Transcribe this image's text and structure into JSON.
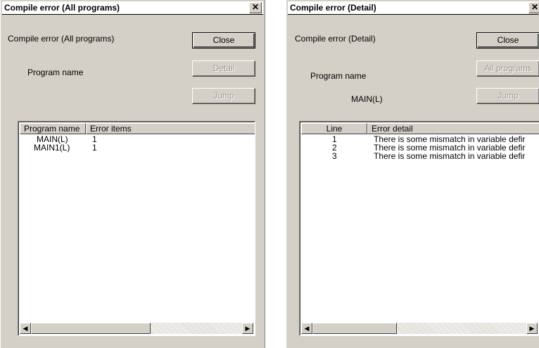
{
  "all_dialog": {
    "title": "Compile error (All programs)",
    "close_box": "✕",
    "caption": "Compile error (All programs)",
    "program_name_label": "Program name",
    "buttons": {
      "close": "Close",
      "detail": "Detail",
      "jump": "Jump"
    },
    "columns": [
      "Program name",
      "Error items"
    ],
    "rows": [
      {
        "program": "MAIN(L)",
        "errors": "1"
      },
      {
        "program": "MAIN1(L)",
        "errors": "1"
      }
    ]
  },
  "detail_dialog": {
    "title": "Compile error (Detail)",
    "close_box": "✕",
    "caption": "Compile error (Detail)",
    "program_name_label": "Program name",
    "program_name_value": "MAIN(L)",
    "buttons": {
      "close": "Close",
      "all_programs": "All programs",
      "jump": "Jump"
    },
    "columns": [
      "Line",
      "Error detail"
    ],
    "rows": [
      {
        "line": "1",
        "detail": "There is some mismatch in variable defir"
      },
      {
        "line": "2",
        "detail": "There is some mismatch in variable defir"
      },
      {
        "line": "3",
        "detail": "There is some mismatch in variable defir"
      }
    ]
  },
  "scrollbar": {
    "left_arrow": "◀",
    "right_arrow": "▶"
  }
}
